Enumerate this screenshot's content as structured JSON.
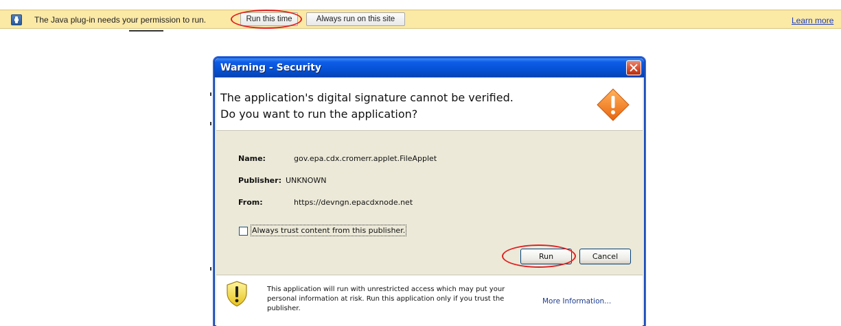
{
  "infobar": {
    "message": "The Java plug-in needs your permission to run.",
    "run_this_time": "Run this time",
    "always_run": "Always run on this site",
    "learn_more": "Learn more"
  },
  "dialog": {
    "title": "Warning - Security",
    "headline_line1": "The application's digital signature cannot be verified.",
    "headline_line2": "Do you want to run the application?",
    "name_label": "Name:",
    "name_value": "gov.epa.cdx.cromerr.applet.FileApplet",
    "publisher_label": "Publisher:",
    "publisher_value": "UNKNOWN",
    "from_label": "From:",
    "from_value": "https://devngn.epacdxnode.net",
    "checkbox_label": "Always trust content from this publisher.",
    "checkbox_checked": false,
    "run_label": "Run",
    "cancel_label": "Cancel",
    "footer_text": "This application will run with unrestricted access which may put your personal information at risk. Run this application only if you trust the publisher.",
    "more_info": "More Information..."
  },
  "colors": {
    "infobar_bg": "#fbe9a6",
    "titlebar": "#0552d6",
    "highlight_circle": "#e02020",
    "dialog_bg": "#ece9d8"
  }
}
